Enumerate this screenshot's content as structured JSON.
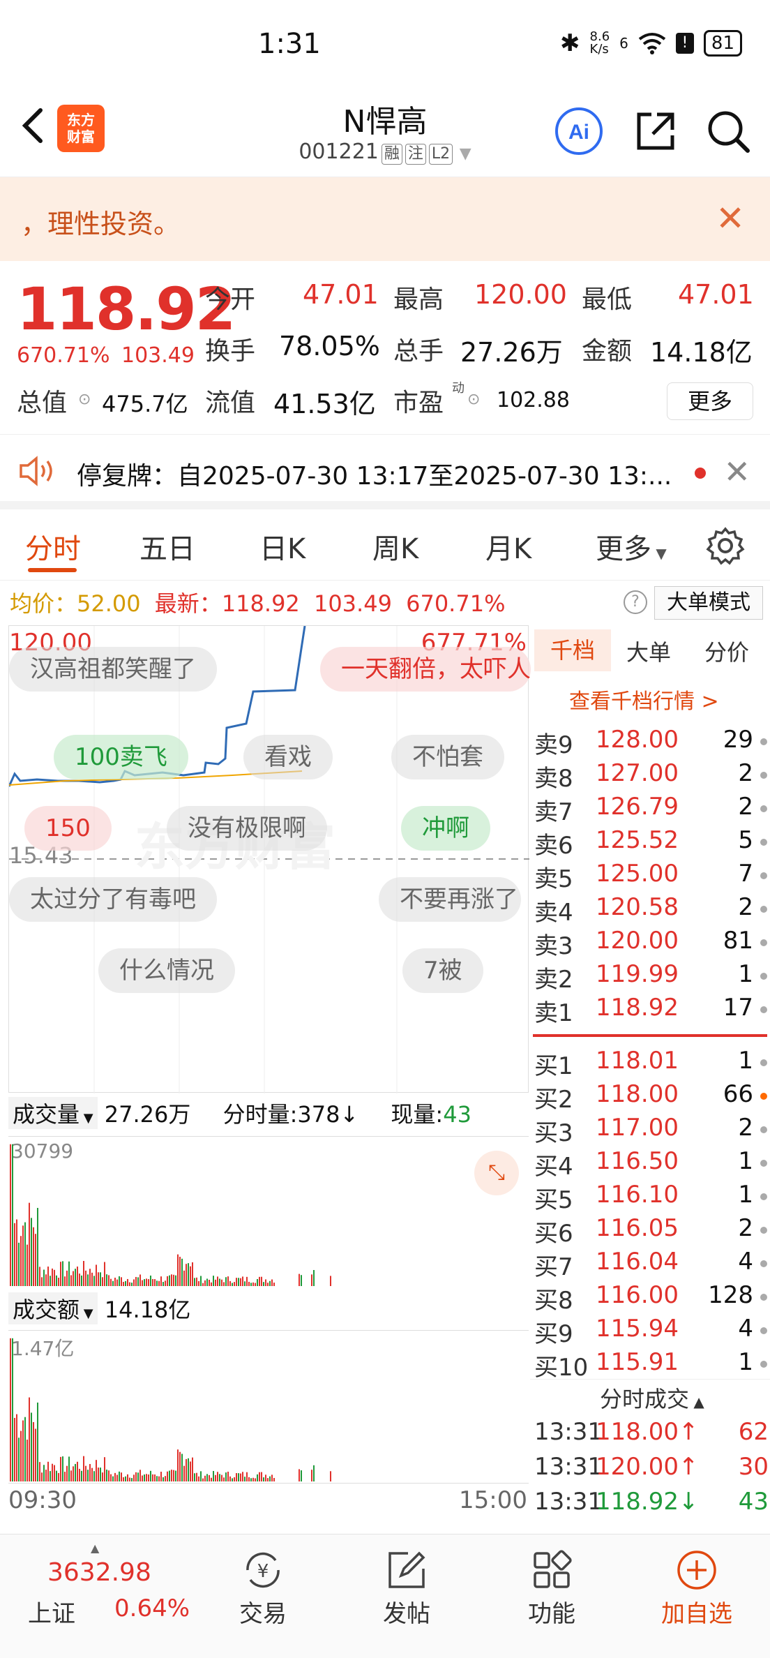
{
  "status_bar": {
    "time": "1:31",
    "speed": "8.6\nK/s",
    "network": "6",
    "battery": "81"
  },
  "header": {
    "logo_text": "东方\n财富",
    "stock_name": "N悍高",
    "stock_code": "001221",
    "tags": [
      "融",
      "注",
      "L2"
    ]
  },
  "banner": {
    "text": "，理性投资。"
  },
  "quote": {
    "price": "118.92",
    "change_pct": "670.71%",
    "change_amt": "103.49",
    "open_label": "今开",
    "open": "47.01",
    "high_label": "最高",
    "high": "120.00",
    "low_label": "最低",
    "low": "47.01",
    "turnover_label": "换手",
    "turnover": "78.05%",
    "volume_label": "总手",
    "volume": "27.26万",
    "amount_label": "金额",
    "amount": "14.18亿",
    "mcap_label": "总值",
    "mcap": "475.7亿",
    "float_label": "流值",
    "float": "41.53亿",
    "pe_label": "市盈",
    "pe_sup": "动",
    "pe": "102.88",
    "more": "更多"
  },
  "suspension": {
    "text": "停复牌：自2025-07-30 13:17至2025-07-30 13:..."
  },
  "tabs": [
    "分时",
    "五日",
    "日K",
    "周K",
    "月K",
    "更多"
  ],
  "avg_line": {
    "avg_label": "均价：",
    "avg": "52.00",
    "latest_label": "最新：",
    "latest": "118.92",
    "chg": "103.49",
    "pct": "670.71%",
    "big_mode": "大单模式",
    "help": "?"
  },
  "chart": {
    "top_price": "120.00",
    "top_pct": "677.71%",
    "mid_price": "15.43",
    "start_time": "09:30",
    "end_time": "15:00"
  },
  "danmaku": [
    "汉高祖都笑醒了",
    "一天翻倍，太吓人",
    "100卖飞",
    "看戏",
    "不怕套",
    "150",
    "没有极限啊",
    "冲啊",
    "太过分了有毒吧",
    "不要再涨了",
    "什么情况",
    "7被"
  ],
  "order_book": {
    "tabs": [
      "千档",
      "大单",
      "分价"
    ],
    "link": "查看千档行情 >",
    "asks": [
      {
        "label": "卖9",
        "price": "128.00",
        "vol": "29"
      },
      {
        "label": "卖8",
        "price": "127.00",
        "vol": "2"
      },
      {
        "label": "卖7",
        "price": "126.79",
        "vol": "2"
      },
      {
        "label": "卖6",
        "price": "125.52",
        "vol": "5"
      },
      {
        "label": "卖5",
        "price": "125.00",
        "vol": "7"
      },
      {
        "label": "卖4",
        "price": "120.58",
        "vol": "2"
      },
      {
        "label": "卖3",
        "price": "120.00",
        "vol": "81"
      },
      {
        "label": "卖2",
        "price": "119.99",
        "vol": "1"
      },
      {
        "label": "卖1",
        "price": "118.92",
        "vol": "17"
      }
    ],
    "bids": [
      {
        "label": "买1",
        "price": "118.01",
        "vol": "1"
      },
      {
        "label": "买2",
        "price": "118.00",
        "vol": "66"
      },
      {
        "label": "买3",
        "price": "117.00",
        "vol": "2"
      },
      {
        "label": "买4",
        "price": "116.50",
        "vol": "1"
      },
      {
        "label": "买5",
        "price": "116.10",
        "vol": "1"
      },
      {
        "label": "买6",
        "price": "116.05",
        "vol": "2"
      },
      {
        "label": "买7",
        "price": "116.04",
        "vol": "4"
      },
      {
        "label": "买8",
        "price": "116.00",
        "vol": "128"
      },
      {
        "label": "买9",
        "price": "115.94",
        "vol": "4"
      },
      {
        "label": "买10",
        "price": "115.91",
        "vol": "1"
      }
    ],
    "trades_title": "分时成交",
    "trades": [
      {
        "time": "13:31",
        "price": "118.00↑",
        "vol": "62"
      },
      {
        "time": "13:31",
        "price": "120.00↑",
        "vol": "30"
      },
      {
        "time": "13:31",
        "price": "118.92↓",
        "vol": "43"
      }
    ]
  },
  "volume": {
    "label": "成交量",
    "total": "27.26万",
    "minute_label": "分时量:378↓",
    "now_label": "现量:",
    "now": "43",
    "max": "30799"
  },
  "amount_panel": {
    "label": "成交额",
    "total": "14.18亿",
    "max": "1.47亿"
  },
  "bottom_nav": {
    "index_value": "3632.98",
    "index_name": "上证",
    "index_pct": "0.64%",
    "items": [
      "交易",
      "发帖",
      "功能",
      "加自选"
    ]
  }
}
